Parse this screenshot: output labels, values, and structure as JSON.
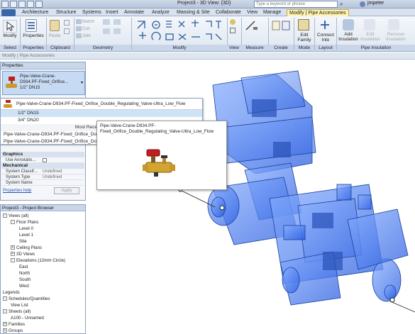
{
  "window": {
    "title": "Project3 - 3D View: {3D}",
    "search_placeholder": "Type a keyword or phrase",
    "user": "jmpeter"
  },
  "tabs": [
    "Architecture",
    "Structure",
    "Systems",
    "Insert",
    "Annotate",
    "Analyze",
    "Massing & Site",
    "Collaborate",
    "View",
    "Manage",
    "Modify | Pipe Accessories"
  ],
  "ribbon": {
    "buttons": {
      "modify": "Modify",
      "properties": "Properties",
      "paste": "Paste",
      "notch": "Notch",
      "cut": "Cut",
      "join": "Join",
      "edit_family": "Edit Family",
      "connect_into": "Connect Into",
      "add_insulation": "Add Insulation",
      "edit_insulation": "Edit Insulation",
      "remove_insulation": "Remove Insulation"
    },
    "panels": [
      "Select",
      "Properties",
      "Clipboard",
      "Geometry",
      "Modify",
      "View",
      "Measure",
      "Create",
      "Mode",
      "Layout",
      "Pipe Insulation"
    ]
  },
  "context_bar": "Modify | Pipe Accessories",
  "properties": {
    "title": "Properties",
    "type_name": "Pipe-Valve-Crane-D934.PF-Fixed_Orifice...",
    "type_name_lines": [
      "Pipe-Valve-Crane-",
      "D934.PF-Fixed_Orifice...",
      "1/2\" DN15"
    ],
    "graphics_header": "Graphics",
    "use_annotation": "Use Annotatio...",
    "mechanical_header": "Mechanical",
    "rows": [
      {
        "label": "System Classif...",
        "value": "Undefined"
      },
      {
        "label": "System Type",
        "value": "Undefined"
      },
      {
        "label": "System Name",
        "value": ""
      }
    ],
    "help_link": "Properties help",
    "apply": "Apply"
  },
  "dropdown": {
    "family": "Pipe-Valve-Crane-D934.PF-Fixed_Orifice_Double_Regulating_Valve-Ultra_Low_Flow",
    "types": [
      "1/2\" DN15",
      "3/4\" DN20"
    ],
    "recent_label": "Most Rece",
    "recent": [
      "Pipe-Valve-Crane-D934.PF-Fixed_Orifice_Doub",
      "Pipe-Valve-Crane-D934.PF-Fixed_Orifice_Doub"
    ]
  },
  "tooltip": {
    "lines": [
      "Pipe-Valve-Crane-D934.PF-",
      "Fixed_Orifice_Double_Regulating_Valve-Ultra_Low_Flow"
    ]
  },
  "project_browser": {
    "title": "Project3 - Project Browser",
    "items": [
      {
        "label": "Views (all)",
        "level": 0,
        "exp": "-"
      },
      {
        "label": "Floor Plans",
        "level": 1,
        "exp": "-"
      },
      {
        "label": "Level 0",
        "level": 2,
        "exp": ""
      },
      {
        "label": "Level 1",
        "level": 2,
        "exp": ""
      },
      {
        "label": "Site",
        "level": 2,
        "exp": ""
      },
      {
        "label": "Ceiling Plans",
        "level": 1,
        "exp": "+"
      },
      {
        "label": "3D Views",
        "level": 1,
        "exp": "+"
      },
      {
        "label": "Elevations (12mm Circle)",
        "level": 1,
        "exp": "-"
      },
      {
        "label": "East",
        "level": 2,
        "exp": ""
      },
      {
        "label": "North",
        "level": 2,
        "exp": ""
      },
      {
        "label": "South",
        "level": 2,
        "exp": ""
      },
      {
        "label": "West",
        "level": 2,
        "exp": ""
      },
      {
        "label": "Legends",
        "level": 0,
        "exp": ""
      },
      {
        "label": "Schedules/Quantities",
        "level": 0,
        "exp": "-"
      },
      {
        "label": "View List",
        "level": 1,
        "exp": ""
      },
      {
        "label": "Sheets (all)",
        "level": 0,
        "exp": "-"
      },
      {
        "label": "A100 - Unnamed",
        "level": 1,
        "exp": ""
      },
      {
        "label": "Families",
        "level": 0,
        "exp": "+"
      },
      {
        "label": "Groups",
        "level": 0,
        "exp": "+"
      }
    ]
  }
}
